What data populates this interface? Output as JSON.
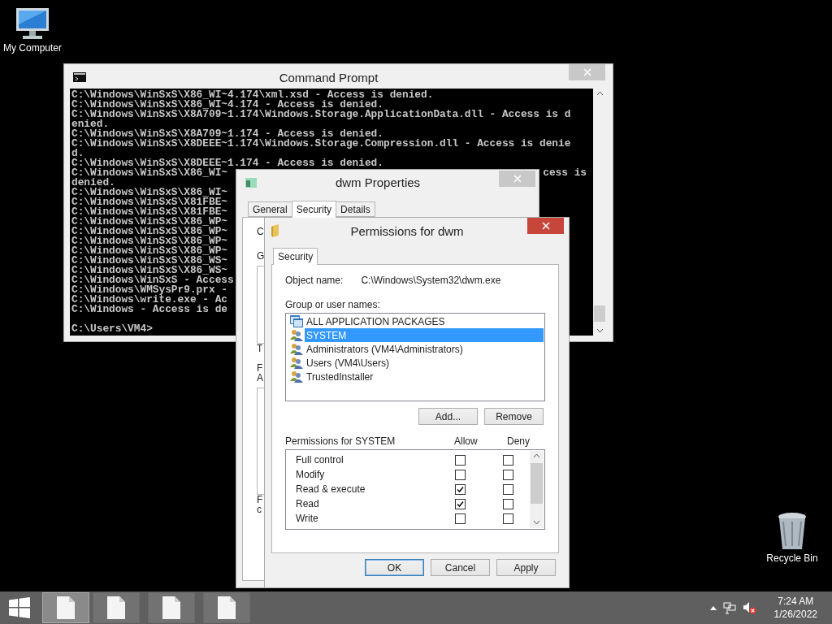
{
  "desktop_icons": [
    {
      "label": "My Computer",
      "kind": "computer"
    },
    {
      "label": "Recycle Bin",
      "kind": "recycle"
    }
  ],
  "command_prompt": {
    "title": "Command Prompt",
    "lines": [
      {
        "text": "C:\\Windows\\WinSxS\\X86_WI~4.174\\xml.xsd - Access is denied."
      },
      {
        "text": "C:\\Windows\\WinSxS\\X86_WI~4.174 - Access is denied."
      },
      {
        "text": "C:\\Windows\\WinSxS\\X8A709~1.174\\Windows.Storage.ApplicationData.dll - Access is d"
      },
      {
        "text": "enied."
      },
      {
        "text": "C:\\Windows\\WinSxS\\X8A709~1.174 - Access is denied."
      },
      {
        "text": "C:\\Windows\\WinSxS\\X8DEEE~1.174\\Windows.Storage.Compression.dll - Access is denie"
      },
      {
        "text": "d."
      },
      {
        "text": "C:\\Windows\\WinSxS\\X8DEEE~1.174 - Access is denied."
      },
      {
        "text": "C:\\Windows\\WinSxS\\X86_WI~",
        "tail": "cess is"
      },
      {
        "text": "denied."
      },
      {
        "text": "C:\\Windows\\WinSxS\\X86_WI~"
      },
      {
        "text": "C:\\Windows\\WinSxS\\X81FBE~"
      },
      {
        "text": "C:\\Windows\\WinSxS\\X81FBE~"
      },
      {
        "text": "C:\\Windows\\WinSxS\\X86_WP~"
      },
      {
        "text": "C:\\Windows\\WinSxS\\X86_WP~"
      },
      {
        "text": "C:\\Windows\\WinSxS\\X86_WP~"
      },
      {
        "text": "C:\\Windows\\WinSxS\\X86_WP~"
      },
      {
        "text": "C:\\Windows\\WinSxS\\X86_WS~"
      },
      {
        "text": "C:\\Windows\\WinSxS\\X86_WS~"
      },
      {
        "text": "C:\\Windows\\WinSxS - Access"
      },
      {
        "text": "C:\\Windows\\WMSysPr9.prx -"
      },
      {
        "text": "C:\\Windows\\write.exe - Ac"
      },
      {
        "text": "C:\\Windows - Access is de"
      }
    ],
    "prompt": "C:\\Users\\VM4>"
  },
  "properties": {
    "title": "dwm Properties",
    "tabs": [
      {
        "label": "General",
        "selected": false
      },
      {
        "label": "Security",
        "selected": true
      },
      {
        "label": "Details",
        "selected": false
      }
    ],
    "fragments": [
      {
        "text": "C",
        "kind": "label"
      },
      {
        "text": "G",
        "kind": "label"
      },
      {
        "kind": "box"
      },
      {
        "text": "T",
        "kind": "label"
      },
      {
        "text": "F",
        "kind": "label"
      },
      {
        "text": "A",
        "kind": "label"
      },
      {
        "kind": "box"
      },
      {
        "text": "F",
        "kind": "label"
      },
      {
        "text": "c",
        "kind": "label"
      }
    ]
  },
  "permissions": {
    "title": "Permissions for dwm",
    "tabs": [
      {
        "label": "Security",
        "selected": true
      }
    ],
    "object_name_label": "Object name:",
    "object_name": "C:\\Windows\\System32\\dwm.exe",
    "group_label": "Group or user names:",
    "groups": [
      {
        "name": "ALL APPLICATION PACKAGES",
        "kind": "package",
        "selected": false
      },
      {
        "name": "SYSTEM",
        "kind": "users",
        "selected": true
      },
      {
        "name": "Administrators (VM4\\Administrators)",
        "kind": "users",
        "selected": false
      },
      {
        "name": "Users (VM4\\Users)",
        "kind": "users",
        "selected": false
      },
      {
        "name": "TrustedInstaller",
        "kind": "users",
        "selected": false
      }
    ],
    "group_buttons": [
      "Add...",
      "Remove"
    ],
    "permissions_label": "Permissions for SYSTEM",
    "allow_header": "Allow",
    "deny_header": "Deny",
    "rows": [
      {
        "name": "Full control",
        "allow": false,
        "deny": false
      },
      {
        "name": "Modify",
        "allow": false,
        "deny": false
      },
      {
        "name": "Read & execute",
        "allow": true,
        "deny": false
      },
      {
        "name": "Read",
        "allow": true,
        "deny": false
      },
      {
        "name": "Write",
        "allow": false,
        "deny": false
      }
    ],
    "buttons": [
      {
        "label": "OK",
        "default": true
      },
      {
        "label": "Cancel",
        "default": false
      },
      {
        "label": "Apply",
        "default": false
      }
    ]
  },
  "taskbar": {
    "tasks": [
      {
        "active": true
      },
      {
        "active": false
      },
      {
        "active": false
      },
      {
        "active": false
      }
    ],
    "time": "7:24 AM",
    "date": "1/26/2022"
  }
}
